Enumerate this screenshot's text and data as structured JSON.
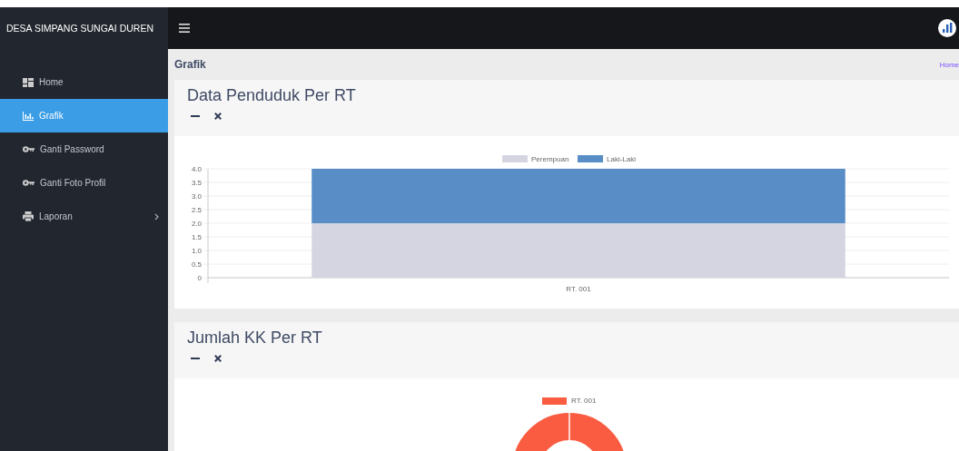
{
  "brand": "DESA SIMPANG SUNGAI DUREN",
  "sidebar": {
    "items": [
      {
        "label": "Home",
        "kind": "dashboard",
        "selected": false,
        "submenu": false
      },
      {
        "label": "Grafik",
        "kind": "chart",
        "selected": true,
        "submenu": false
      },
      {
        "label": "Ganti Password",
        "kind": "key",
        "selected": false,
        "submenu": false
      },
      {
        "label": "Ganti Foto Profil",
        "kind": "key",
        "selected": false,
        "submenu": false
      },
      {
        "label": "Laporan",
        "kind": "print",
        "selected": false,
        "submenu": true
      }
    ]
  },
  "page": {
    "title": "Grafik",
    "breadcrumb": "Home"
  },
  "cards": [
    {
      "kind": "bar",
      "title": "Data Penduduk Per RT",
      "chart_data": {
        "type": "bar",
        "categories": [
          "RT. 001"
        ],
        "stacked": true,
        "ylim": [
          0,
          4
        ],
        "grid": true,
        "legend": true,
        "yticks": [
          0,
          0.5,
          {
            "value": 1,
            "label": "1.0"
          },
          1.5,
          {
            "value": 2,
            "label": "2.0"
          },
          2.5,
          {
            "value": 3,
            "label": "3.0"
          },
          3.5,
          {
            "value": 4,
            "label": "4.0"
          }
        ],
        "series": [
          {
            "name": "Perempuan",
            "color": "#d5d5e1",
            "values": [
              2
            ]
          },
          {
            "name": "Laki-Laki",
            "color": "#588dc6",
            "values": [
              2
            ]
          }
        ]
      }
    },
    {
      "kind": "donut",
      "title": "Jumlah KK Per RT",
      "slices": [
        {
          "label": "RT. 001",
          "color": "#f95c40"
        }
      ]
    }
  ]
}
